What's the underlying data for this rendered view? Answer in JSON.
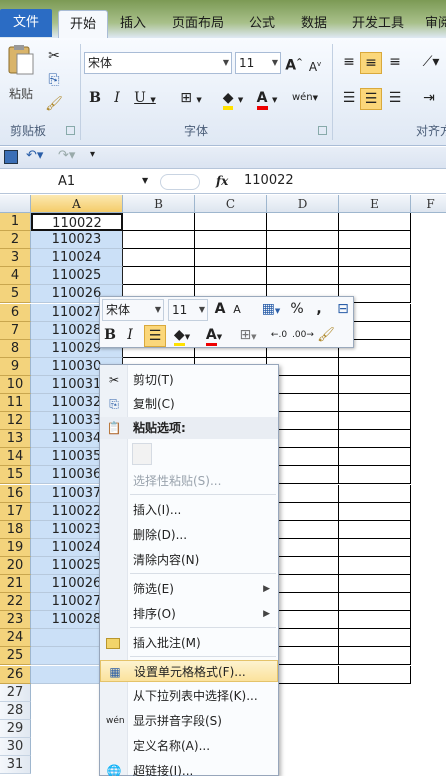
{
  "tabs": [
    "文件",
    "开始",
    "插入",
    "页面布局",
    "公式",
    "数据",
    "开发工具",
    "审阅"
  ],
  "ribbon": {
    "clipboard_label": "剪贴板",
    "paste_label": "粘贴",
    "font_label": "字体",
    "font_name": "宋体",
    "font_size": "11",
    "align_label": "对齐方"
  },
  "formula": {
    "name_box": "A1",
    "fx": "fx",
    "value": "110022"
  },
  "columns": [
    "A",
    "B",
    "C",
    "D",
    "E",
    "F"
  ],
  "rows": [
    "1",
    "2",
    "3",
    "4",
    "5",
    "6",
    "7",
    "8",
    "9",
    "10",
    "11",
    "12",
    "13",
    "14",
    "15",
    "16",
    "17",
    "18",
    "19",
    "20",
    "21",
    "22",
    "23",
    "24",
    "25",
    "26",
    "27",
    "28",
    "29",
    "30",
    "31"
  ],
  "col_a_values": [
    "110022",
    "110023",
    "110024",
    "110025",
    "110026",
    "110027",
    "110028",
    "110029",
    "110030",
    "110031",
    "110032",
    "110033",
    "110034",
    "110035",
    "110036",
    "110037",
    "110022",
    "110023",
    "110024",
    "110025",
    "110026",
    "110027",
    "110028"
  ],
  "mini_toolbar": {
    "font_name": "宋体",
    "font_size": "11",
    "percent": "%",
    "comma": ","
  },
  "context_menu": {
    "cut": "剪切(T)",
    "copy": "复制(C)",
    "paste_options": "粘贴选项:",
    "paste_special": "选择性粘贴(S)...",
    "insert": "插入(I)...",
    "delete": "删除(D)...",
    "clear": "清除内容(N)",
    "filter": "筛选(E)",
    "sort": "排序(O)",
    "insert_comment": "插入批注(M)",
    "format_cells": "设置单元格格式(F)...",
    "pick_list": "从下拉列表中选择(K)...",
    "phonetic": "显示拼音字段(S)",
    "define_name": "定义名称(A)...",
    "hyperlink": "超链接(I)..."
  }
}
